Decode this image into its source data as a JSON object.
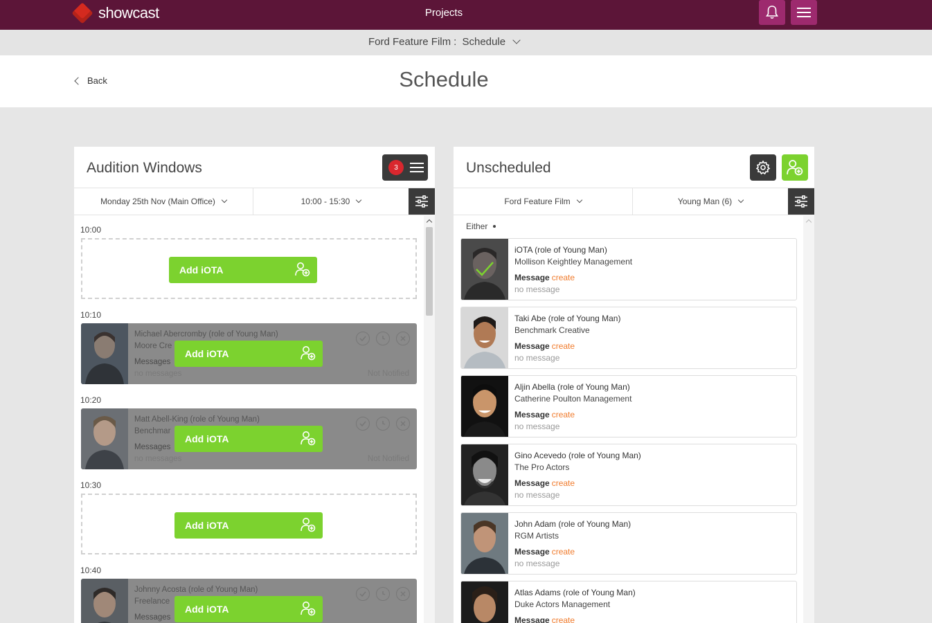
{
  "app": {
    "brand": "showcast",
    "nav_title": "Projects"
  },
  "breadcrumb": {
    "project": "Ford Feature Film",
    "separator": ":",
    "section": "Schedule"
  },
  "header": {
    "back_label": "Back",
    "title": "Schedule"
  },
  "colors": {
    "brand_bar": "#5c1538",
    "accent_button": "#9d2a6e",
    "green": "#7cd22f",
    "orange_link": "#f07b2c",
    "badge_red": "#d9272e",
    "dark_button": "#3a3a3a"
  },
  "audition_windows": {
    "title": "Audition Windows",
    "badge_count": "3",
    "date_filter": "Monday 25th Nov (Main Office)",
    "time_filter": "10:00 - 15:30",
    "add_label": "Add iOTA",
    "slots": [
      {
        "time": "10:00",
        "type": "empty"
      },
      {
        "time": "10:10",
        "type": "booked",
        "name": "Michael Abercromby (role of Young Man)",
        "agency": "Moore Cre",
        "messages_label": "Messages",
        "no_messages": "no messages",
        "status": "Not Notified"
      },
      {
        "time": "10:20",
        "type": "booked",
        "name": "Matt Abell-King (role of Young Man)",
        "agency": "Benchmar",
        "messages_label": "Messages",
        "no_messages": "no messages",
        "status": "Not Notified"
      },
      {
        "time": "10:30",
        "type": "empty"
      },
      {
        "time": "10:40",
        "type": "booked",
        "name": "Johnny Acosta (role of Young Man)",
        "agency": "Freelance",
        "messages_label": "Messages",
        "no_messages": "",
        "status": ""
      }
    ]
  },
  "unscheduled": {
    "title": "Unscheduled",
    "project_filter": "Ford Feature Film",
    "role_filter": "Young Man (6)",
    "group_label": "Either",
    "message_label": "Message",
    "create_label": "create",
    "no_message": "no message",
    "cards": [
      {
        "name": "iOTA (role of Young Man)",
        "agency": "Mollison Keightley Management"
      },
      {
        "name": "Taki Abe (role of Young Man)",
        "agency": "Benchmark Creative"
      },
      {
        "name": "Aljin Abella (role of Young Man)",
        "agency": "Catherine Poulton Management"
      },
      {
        "name": "Gino Acevedo (role of Young Man)",
        "agency": "The Pro Actors"
      },
      {
        "name": "John Adam (role of Young Man)",
        "agency": "RGM Artists"
      },
      {
        "name": "Atlas Adams (role of Young Man)",
        "agency": "Duke Actors Management"
      }
    ]
  }
}
